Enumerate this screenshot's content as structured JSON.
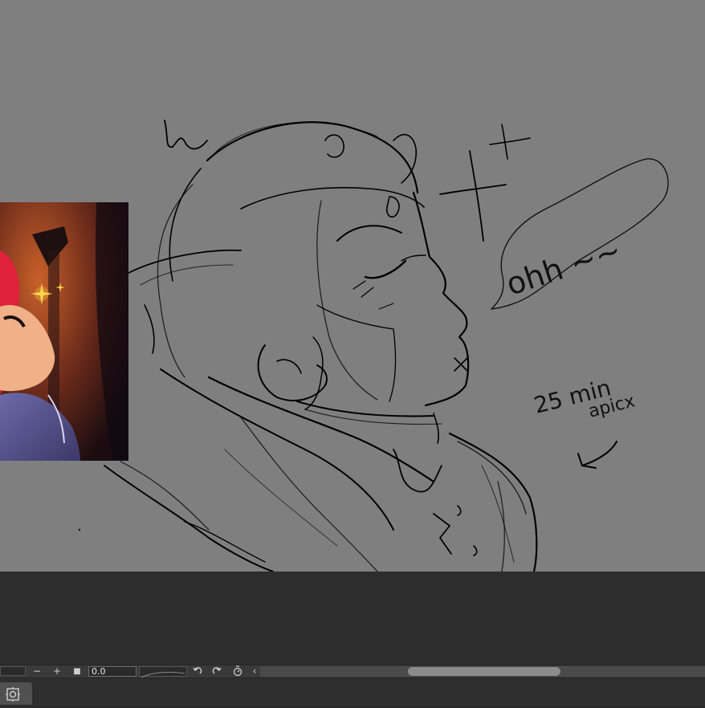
{
  "canvas": {
    "handwriting_ohh": "ohh ~~",
    "note_line1": "25 min",
    "note_line2": "apicx",
    "background_color": "#7f7f7f"
  },
  "toolbar": {
    "minus_label": "−",
    "plus_label": "+",
    "stop_label": "■",
    "zoom_value": "0.0",
    "undo_icon": "undo-icon",
    "redo_icon": "redo-icon",
    "reset_icon": "reset-rotation-icon",
    "collapse_label": "‹"
  },
  "statusbar": {
    "navigator_icon": "navigator-icon"
  },
  "colors": {
    "panel_dark": "#2d2d2d",
    "toolbar": "#3a3a3a",
    "reference_glow": "#ffd84a",
    "reference_red": "#e0213a"
  }
}
